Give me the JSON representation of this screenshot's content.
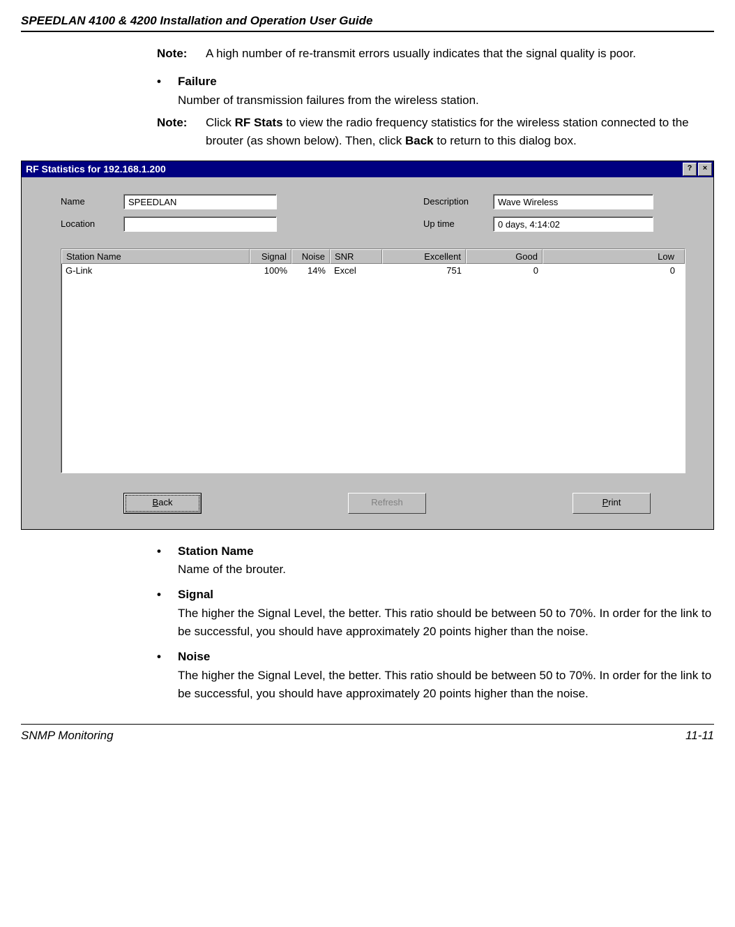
{
  "header": {
    "title": "SPEEDLAN 4100 & 4200 Installation and Operation User Guide"
  },
  "intro": {
    "note_label": "Note:",
    "note1": "A high number of re-transmit errors usually indicates that the signal quality is poor.",
    "failure_title": "Failure",
    "failure_desc": "Number of transmission failures from the wireless station.",
    "note2_prefix": "Click ",
    "note2_bold1": "RF Stats",
    "note2_mid": " to view the radio frequency statistics for the wireless station connected to the brouter (as shown below). Then, click ",
    "note2_bold2": "Back",
    "note2_suffix": " to return to this dialog box."
  },
  "dialog": {
    "title": "RF Statistics for 192.168.1.200",
    "help_btn": "?",
    "close_btn": "×",
    "labels": {
      "name": "Name",
      "location": "Location",
      "description": "Description",
      "uptime": "Up time"
    },
    "values": {
      "name": "SPEEDLAN",
      "location": "",
      "description": "Wave Wireless",
      "uptime": "0 days, 4:14:02"
    },
    "columns": {
      "c1": "Station Name",
      "c2": "Signal",
      "c3": "Noise",
      "c4": "SNR",
      "c5": "Excellent",
      "c6": "Good",
      "c7": "Low"
    },
    "row": {
      "c1": "G-Link",
      "c2": "100%",
      "c3": "14%",
      "c4": "Excel",
      "c5": "751",
      "c6": "0",
      "c7": "0"
    },
    "buttons": {
      "back": "Back",
      "refresh": "Refresh",
      "print": "Print"
    }
  },
  "post": {
    "station_title": "Station Name",
    "station_desc": "Name of the brouter.",
    "signal_title": "Signal",
    "signal_desc": "The higher the Signal Level, the better. This ratio should be between 50 to 70%. In order for the link to be successful, you should have approximately 20 points higher than the noise.",
    "noise_title": "Noise",
    "noise_desc": "The higher the Signal Level, the better. This ratio should be between 50 to 70%. In order for the link to be successful, you should have approximately 20 points higher than the noise."
  },
  "footer": {
    "left": "SNMP Monitoring",
    "right": "11-11"
  }
}
